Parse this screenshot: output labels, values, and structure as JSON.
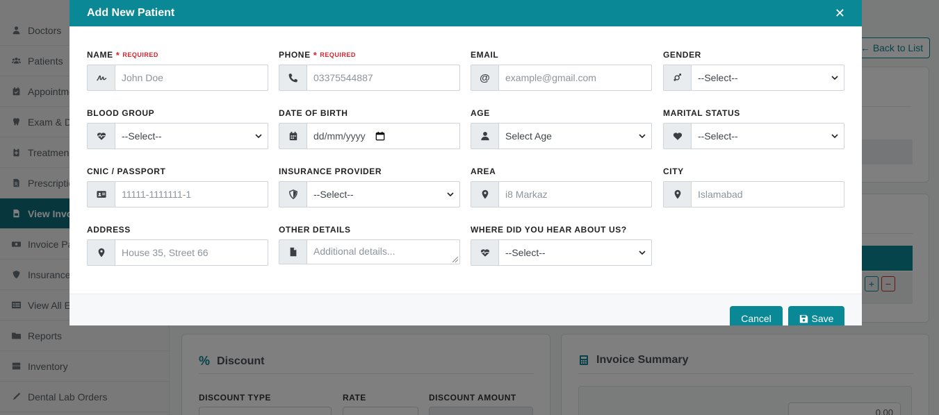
{
  "sidebar": {
    "items": [
      {
        "label": "Doctors",
        "icon": "user-md-icon"
      },
      {
        "label": "Patients",
        "icon": "users-icon"
      },
      {
        "label": "Appointme",
        "icon": "calendar-check-icon"
      },
      {
        "label": "Exam & D",
        "icon": "tooth-icon"
      },
      {
        "label": "Treatmen",
        "icon": "clipboard-icon"
      },
      {
        "label": "Prescriptio",
        "icon": "prescription-icon"
      },
      {
        "label": "View Invo",
        "icon": "file-invoice-icon",
        "active": true
      },
      {
        "label": "Invoice Pa",
        "icon": "money-icon"
      },
      {
        "label": "Insurance",
        "icon": "shield-icon"
      },
      {
        "label": "View All E",
        "icon": "list-icon"
      },
      {
        "label": "Reports",
        "icon": "folder-icon"
      },
      {
        "label": "Inventory",
        "icon": "boxes-icon"
      },
      {
        "label": "Dental Lab Orders",
        "icon": "flask-icon"
      }
    ]
  },
  "page": {
    "back_to_list": "Back to List",
    "discount": {
      "title": "Discount",
      "discount_type_label": "DISCOUNT TYPE",
      "rate_label": "RATE",
      "discount_amount_label": "DISCOUNT AMOUNT"
    },
    "invoice_summary": {
      "title": "Invoice Summary",
      "value": "0.00"
    }
  },
  "modal": {
    "title": "Add New Patient",
    "close_symbol": "✕",
    "required_text": "REQUIRED",
    "fields": {
      "name": {
        "label": "NAME",
        "placeholder": "John Doe"
      },
      "phone": {
        "label": "PHONE",
        "placeholder": "03375544887"
      },
      "email": {
        "label": "EMAIL",
        "placeholder": "example@gmail.com"
      },
      "gender": {
        "label": "GENDER",
        "value": "--Select--"
      },
      "blood_group": {
        "label": "BLOOD GROUP",
        "value": "--Select--"
      },
      "dob": {
        "label": "DATE OF BIRTH",
        "value": "dd/mm/yyyy"
      },
      "age": {
        "label": "AGE",
        "value": "Select Age"
      },
      "marital_status": {
        "label": "MARITAL STATUS",
        "value": "--Select--"
      },
      "cnic": {
        "label": "CNIC / PASSPORT",
        "placeholder": "11111-1111111-1"
      },
      "insurance": {
        "label": "INSURANCE PROVIDER",
        "value": "--Select--"
      },
      "area": {
        "label": "AREA",
        "placeholder": "i8 Markaz"
      },
      "city": {
        "label": "CITY",
        "placeholder": "Islamabad"
      },
      "address": {
        "label": "ADDRESS",
        "placeholder": "House 35, Street 66"
      },
      "other_details": {
        "label": "OTHER DETAILS",
        "placeholder": "Additional details..."
      },
      "referral": {
        "label": "WHERE DID YOU HEAR ABOUT US?",
        "value": "--Select--"
      }
    },
    "cancel_label": "Cancel",
    "save_label": "Save"
  },
  "colors": {
    "primary": "#0b8895",
    "required": "#d9232d",
    "sidebar_active": "#0e6d7a"
  }
}
